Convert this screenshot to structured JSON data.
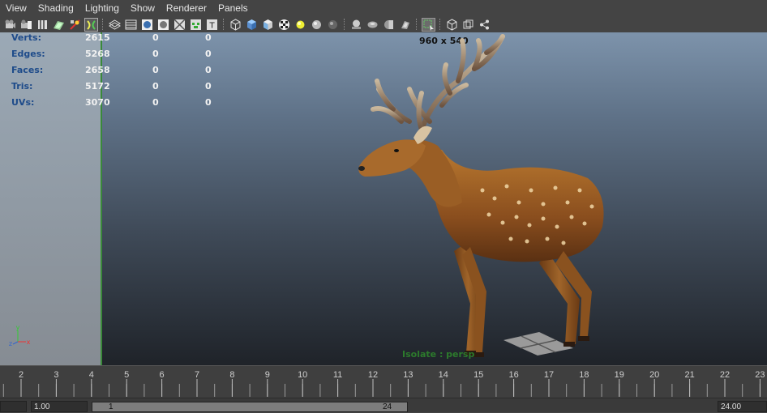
{
  "menu": [
    "View",
    "Shading",
    "Lighting",
    "Show",
    "Renderer",
    "Panels"
  ],
  "toolbar": {
    "icons": [
      "camera-icon",
      "camera-attributes-icon",
      "bookmark-icon",
      "image-plane-icon",
      "grid-snap-icon",
      "film-gate-icon",
      "wireframe-icon",
      "smooth-shade-icon",
      "flat-shade-icon",
      "bounding-box-icon",
      "default-material-icon",
      "textured-icon",
      "xray-icon",
      "high-quality-icon",
      "use-lights-icon",
      "shadows-icon",
      "cube-wire-icon",
      "cube-shaded-icon",
      "cube-textured-icon",
      "checker-icon",
      "light-bulb-icon",
      "sphere-grey-icon",
      "sphere-dark-icon",
      "flat-light-icon",
      "ambient-light-icon",
      "point-light-icon",
      "spot-light-icon",
      "isolate-select-icon",
      "cube-outline-icon",
      "two-panes-icon",
      "share-icon"
    ]
  },
  "stats": [
    {
      "label": "Verts:",
      "v1": "2615",
      "v2": "0",
      "v3": "0"
    },
    {
      "label": "Edges:",
      "v1": "5268",
      "v2": "0",
      "v3": "0"
    },
    {
      "label": "Faces:",
      "v1": "2658",
      "v2": "0",
      "v3": "0"
    },
    {
      "label": "Tris:",
      "v1": "5172",
      "v2": "0",
      "v3": "0"
    },
    {
      "label": "UVs:",
      "v1": "3070",
      "v2": "0",
      "v3": "0"
    }
  ],
  "viewport": {
    "resolution_label": "960 x 540",
    "isolate_label": "Isolate : persp",
    "axis": {
      "y": "y",
      "x": "x",
      "z": "z"
    }
  },
  "timeline": {
    "ticks": [
      "2",
      "3",
      "4",
      "5",
      "6",
      "7",
      "8",
      "9",
      "10",
      "11",
      "12",
      "13",
      "14",
      "15",
      "16",
      "17",
      "18",
      "19",
      "20",
      "21",
      "22",
      "23"
    ]
  },
  "range": {
    "start_value": "1.00",
    "slider_start": "1",
    "slider_end": "24",
    "end_value": "24.00"
  },
  "colors": {
    "stat_label": "#1e4b8a",
    "isolate_text": "#2c7a2c",
    "panel_border": "#3a8a3a"
  }
}
